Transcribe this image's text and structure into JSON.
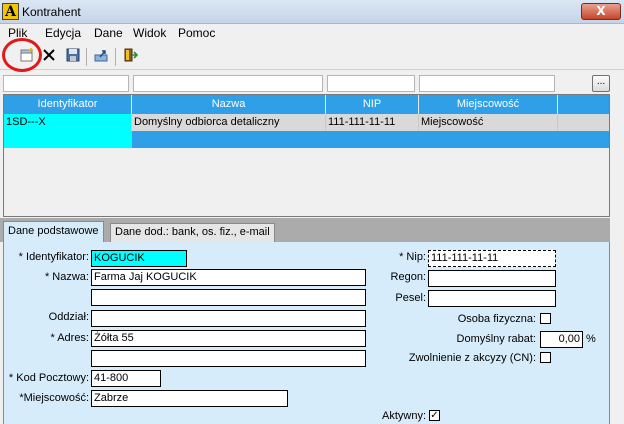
{
  "window": {
    "title": "Kontrahent",
    "close_glyph": "X",
    "app_icon_letter": "A"
  },
  "menu": [
    "Plik",
    "Edycja",
    "Dane",
    "Widok",
    "Pomoc"
  ],
  "toolbar": {
    "icons": [
      "new-record-icon",
      "delete-icon",
      "save-icon",
      "export-icon",
      "exit-icon"
    ]
  },
  "filter": {
    "ellipsis_label": "..."
  },
  "grid": {
    "columns": [
      "Identyfikator",
      "Nazwa",
      "NIP",
      "Miejscowość"
    ],
    "rows": [
      [
        "1SD---X",
        "Domyślny odbiorca detaliczny",
        "111-111-11-11",
        "Miejscowość"
      ]
    ],
    "header_color": "#2fa0e8",
    "selected_row_color": "#2fa0e8"
  },
  "tabs": [
    "Dane podstawowe",
    "Dane dod.: bank, os. fiz., e-mail"
  ],
  "form": {
    "identyfikator_label": "* Identyfikator:",
    "identyfikator_value": "KOGUCIK",
    "nazwa_label": "* Nazwa:",
    "nazwa_value": "Farma Jaj KOGUCIK",
    "nazwa2_value": "",
    "oddzial_label": "Oddział:",
    "oddzial_value": "",
    "adres_label": "* Adres:",
    "adres_value": "Żółta 55",
    "adres2_value": "",
    "kod_label": "* Kod Pocztowy:",
    "kod_value": "41-800",
    "miejscowosc_label": "*Miejscowość:",
    "miejscowosc_value": "Zabrze",
    "nip_label": "* Nip:",
    "nip_value": "111-111-11-11",
    "regon_label": "Regon:",
    "regon_value": "",
    "pesel_label": "Pesel:",
    "pesel_value": "",
    "osoba_label": "Osoba fizyczna:",
    "osoba_checked": false,
    "rabat_label": "Domyślny rabat:",
    "rabat_value": "0,00",
    "rabat_unit": "%",
    "zwolnienie_label": "Zwolnienie z akcyzy (CN):",
    "zwolnienie_checked": false,
    "aktywny_label": "Aktywny:",
    "aktywny_mark": "✓"
  }
}
